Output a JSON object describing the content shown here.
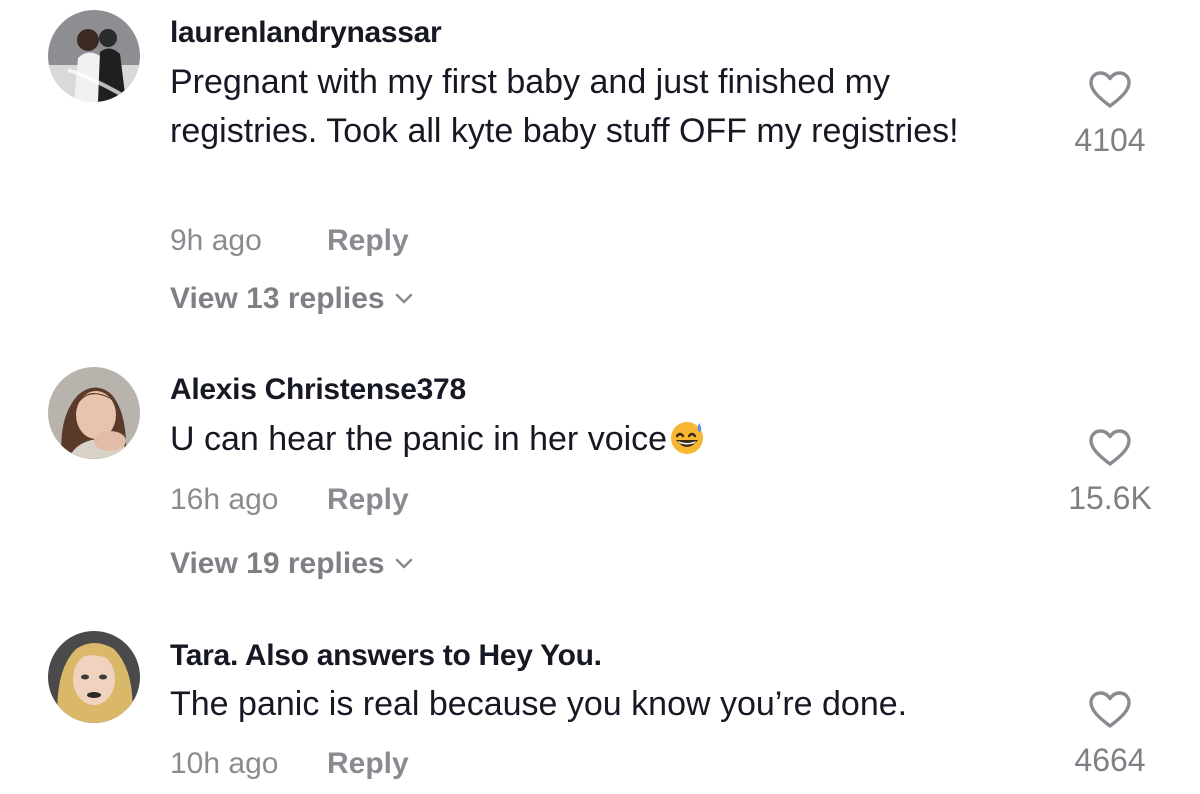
{
  "comments": [
    {
      "username": "laurenlandrynassar",
      "text": "Pregnant with my first baby and just finished my registries. Took all kyte baby stuff OFF my registries!",
      "time": "9h ago",
      "reply_label": "Reply",
      "view_replies": "View 13 replies",
      "likes": "4104",
      "avatar": "avatar-photo-couple"
    },
    {
      "username": "Alexis Christense378",
      "text": "U can hear the panic in her voice",
      "emoji": "grinning-sweat-emoji",
      "time": "16h ago",
      "reply_label": "Reply",
      "view_replies": "View 19 replies",
      "likes": "15.6K",
      "avatar": "avatar-photo-woman"
    },
    {
      "username": "Tara. Also answers to Hey You.",
      "text": "The panic is real because you know you’re done.",
      "time": "10h ago",
      "reply_label": "Reply",
      "likes": "4664",
      "avatar": "avatar-photo-woman-blonde"
    }
  ],
  "icons": {
    "like": "heart-outline-icon",
    "expand": "chevron-down-icon"
  },
  "colors": {
    "text_primary": "#161823",
    "text_secondary": "#8a8b91",
    "background": "#ffffff"
  }
}
